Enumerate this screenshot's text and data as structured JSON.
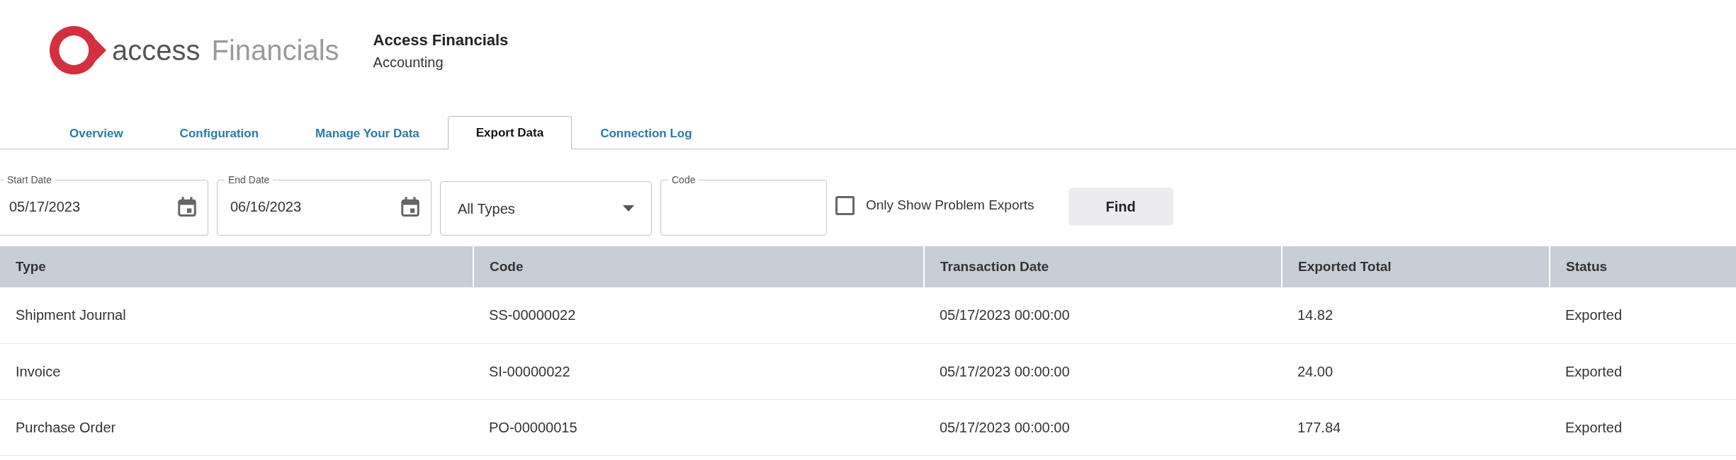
{
  "header": {
    "logo": {
      "brand": "access",
      "product": "Financials"
    },
    "title": "Access Financials",
    "subtitle": "Accounting"
  },
  "tabs": [
    {
      "label": "Overview",
      "selected": false
    },
    {
      "label": "Configuration",
      "selected": false
    },
    {
      "label": "Manage Your Data",
      "selected": false
    },
    {
      "label": "Export Data",
      "selected": true
    },
    {
      "label": "Connection Log",
      "selected": false
    }
  ],
  "filters": {
    "start_date": {
      "label": "Start Date",
      "value": "05/17/2023"
    },
    "end_date": {
      "label": "End Date",
      "value": "06/16/2023"
    },
    "type": {
      "value": "All Types"
    },
    "code": {
      "label": "Code"
    },
    "problem_only": {
      "label": "Only Show Problem Exports",
      "checked": false
    },
    "find_button": "Find"
  },
  "table": {
    "columns": [
      "Type",
      "Code",
      "Transaction Date",
      "Exported Total",
      "Status"
    ],
    "rows": [
      [
        "Shipment Journal",
        "SS-00000022",
        "05/17/2023 00:00:00",
        "14.82",
        "Exported"
      ],
      [
        "Invoice",
        "SI-00000022",
        "05/17/2023 00:00:00",
        "24.00",
        "Exported"
      ],
      [
        "Purchase Order",
        "PO-00000015",
        "05/17/2023 00:00:00",
        "177.84",
        "Exported"
      ]
    ]
  }
}
